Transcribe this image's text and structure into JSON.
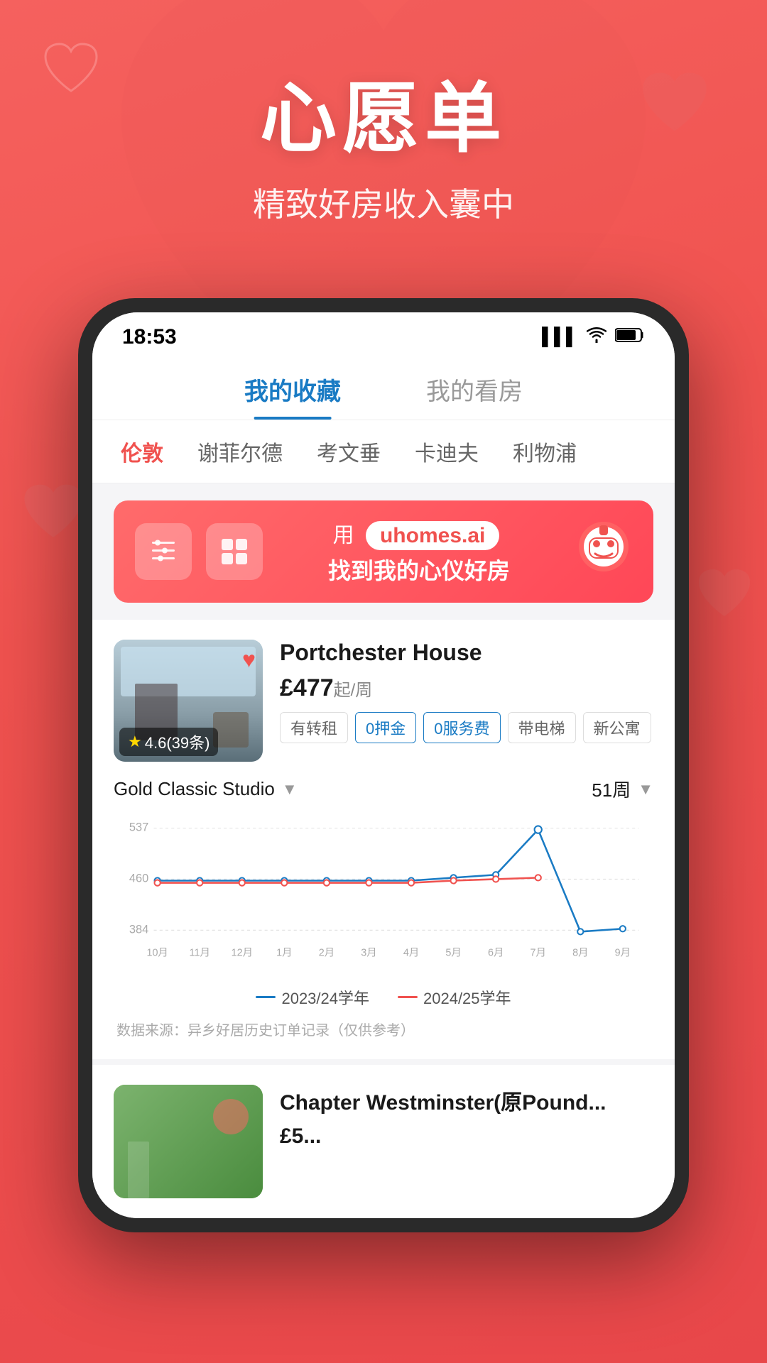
{
  "background": {
    "color": "#f0524f"
  },
  "header": {
    "title": "心愿单",
    "subtitle": "精致好房收入囊中"
  },
  "phone": {
    "status_bar": {
      "time": "18:53",
      "signal": "▌▌▌",
      "wifi": "WiFi",
      "battery": "🔋"
    },
    "tabs": [
      {
        "label": "我的收藏",
        "active": true
      },
      {
        "label": "我的看房",
        "active": false
      }
    ],
    "city_filters": [
      {
        "label": "伦敦",
        "active": true
      },
      {
        "label": "谢菲尔德",
        "active": false
      },
      {
        "label": "考文垂",
        "active": false
      },
      {
        "label": "卡迪夫",
        "active": false
      },
      {
        "label": "利物浦",
        "active": false
      }
    ],
    "ai_banner": {
      "prefix": "用",
      "domain": "uhomes.ai",
      "suffix": "找到我的心仪好房"
    },
    "property1": {
      "name": "Portchester House",
      "price": "£477",
      "price_suffix": "起/周",
      "rating": "4.6(39条)",
      "tags": [
        "有转租",
        "0押金",
        "0服务费",
        "带电梯",
        "新公寓"
      ]
    },
    "chart": {
      "room_type": "Gold Classic Studio",
      "weeks": "51周",
      "y_labels": [
        "537",
        "460",
        "384"
      ],
      "x_labels": [
        "10月",
        "11月",
        "12月",
        "1月",
        "2月",
        "3月",
        "4月",
        "5月",
        "6月",
        "7月",
        "8月",
        "9月"
      ],
      "legend": {
        "line1": "2023/24学年",
        "line2": "2024/25学年"
      },
      "footnote": "数据来源：异乡好居历史订单记录（仅供参考）"
    },
    "property2": {
      "name": "Chapter Westminster(原Pound...",
      "price": "£5...",
      "price_suffix": ""
    }
  }
}
